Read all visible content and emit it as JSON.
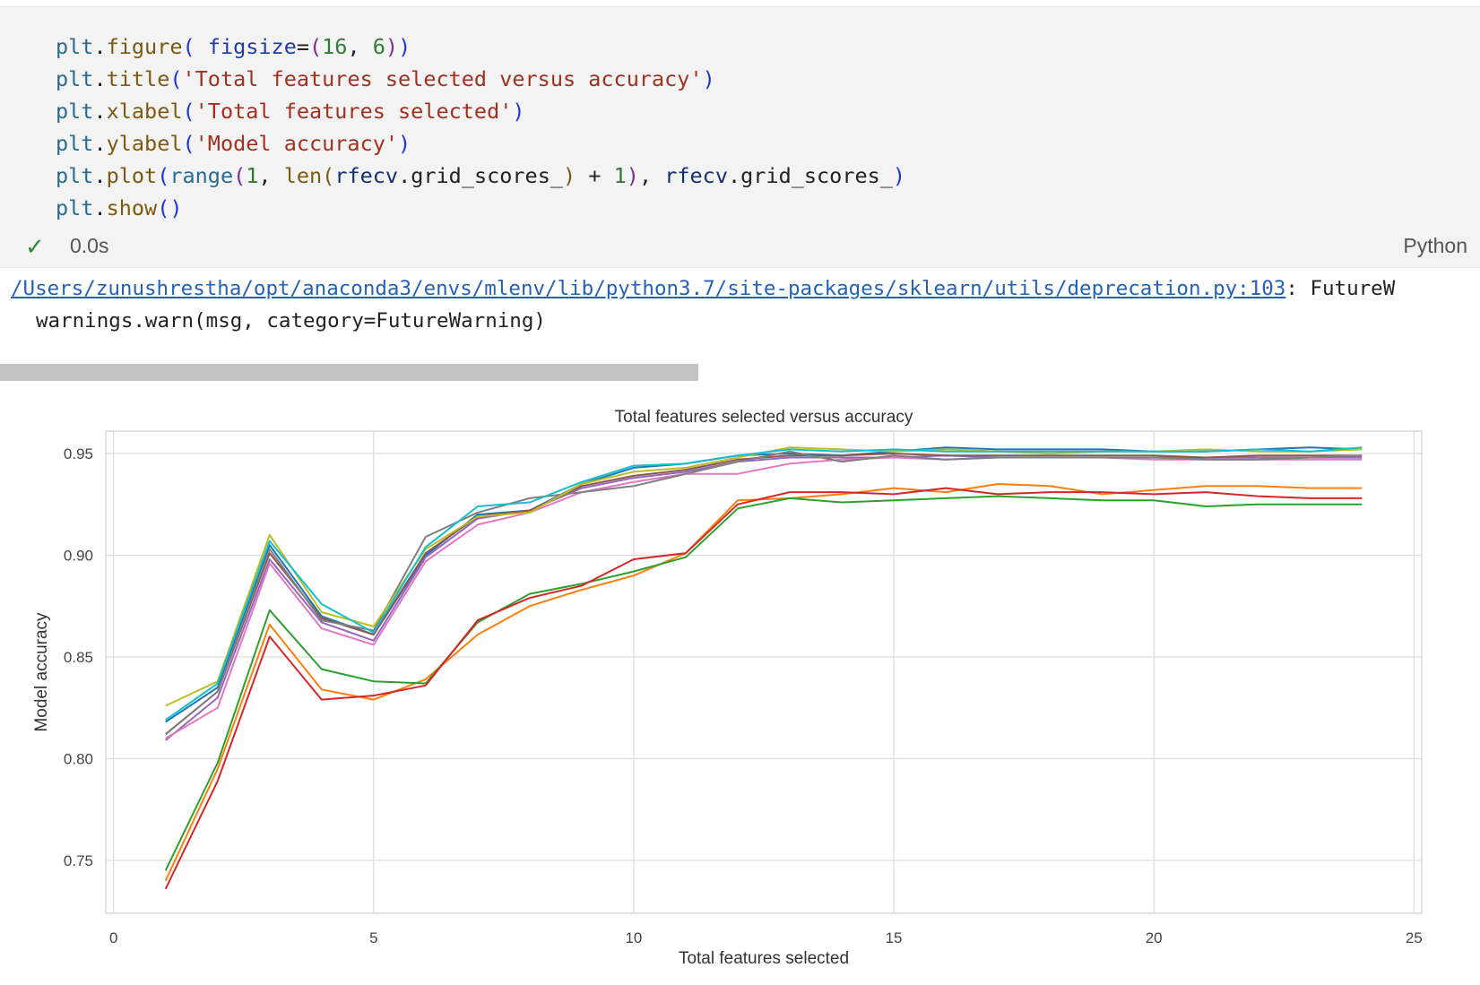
{
  "code_cell": {
    "lines": [
      [
        {
          "t": "plt",
          "c": "v"
        },
        {
          "t": ".",
          "c": "o"
        },
        {
          "t": "figure",
          "c": "f"
        },
        {
          "t": "(",
          "c": "p1"
        },
        {
          "t": " figsize",
          "c": "a"
        },
        {
          "t": "=",
          "c": "o"
        },
        {
          "t": "(",
          "c": "p2"
        },
        {
          "t": "16",
          "c": "n"
        },
        {
          "t": ", ",
          "c": "o"
        },
        {
          "t": "6",
          "c": "n"
        },
        {
          "t": ")",
          "c": "p2"
        },
        {
          "t": ")",
          "c": "p1"
        }
      ],
      [
        {
          "t": "plt",
          "c": "v"
        },
        {
          "t": ".",
          "c": "o"
        },
        {
          "t": "title",
          "c": "f"
        },
        {
          "t": "(",
          "c": "p1"
        },
        {
          "t": "'Total features selected versus accuracy'",
          "c": "s"
        },
        {
          "t": ")",
          "c": "p1"
        }
      ],
      [
        {
          "t": "plt",
          "c": "v"
        },
        {
          "t": ".",
          "c": "o"
        },
        {
          "t": "xlabel",
          "c": "f"
        },
        {
          "t": "(",
          "c": "p1"
        },
        {
          "t": "'Total features selected'",
          "c": "s"
        },
        {
          "t": ")",
          "c": "p1"
        }
      ],
      [
        {
          "t": "plt",
          "c": "v"
        },
        {
          "t": ".",
          "c": "o"
        },
        {
          "t": "ylabel",
          "c": "f"
        },
        {
          "t": "(",
          "c": "p1"
        },
        {
          "t": "'Model accuracy'",
          "c": "s"
        },
        {
          "t": ")",
          "c": "p1"
        }
      ],
      [
        {
          "t": "plt",
          "c": "v"
        },
        {
          "t": ".",
          "c": "o"
        },
        {
          "t": "plot",
          "c": "f"
        },
        {
          "t": "(",
          "c": "p1"
        },
        {
          "t": "range",
          "c": "v"
        },
        {
          "t": "(",
          "c": "p2"
        },
        {
          "t": "1",
          "c": "n"
        },
        {
          "t": ", ",
          "c": "o"
        },
        {
          "t": "len",
          "c": "f"
        },
        {
          "t": "(",
          "c": "f"
        },
        {
          "t": "rfecv",
          "c": "id"
        },
        {
          "t": ".grid_scores_",
          "c": "o"
        },
        {
          "t": ")",
          "c": "f"
        },
        {
          "t": " + ",
          "c": "o"
        },
        {
          "t": "1",
          "c": "n"
        },
        {
          "t": ")",
          "c": "p2"
        },
        {
          "t": ", ",
          "c": "o"
        },
        {
          "t": "rfecv",
          "c": "id"
        },
        {
          "t": ".grid_scores_",
          "c": "o"
        },
        {
          "t": ")",
          "c": "p1"
        }
      ],
      [
        {
          "t": "plt",
          "c": "v"
        },
        {
          "t": ".",
          "c": "o"
        },
        {
          "t": "show",
          "c": "f"
        },
        {
          "t": "()",
          "c": "p1"
        }
      ]
    ],
    "status": {
      "check_icon": "check-icon",
      "time": "0.0s",
      "language": "Python"
    }
  },
  "output": {
    "warning_path": "/Users/zunushrestha/opt/anaconda3/envs/mlenv/lib/python3.7/site-packages/sklearn/utils/deprecation.py:103",
    "warning_rest": ": FutureW",
    "warning_line2": "warnings.warn(msg, category=FutureWarning)"
  },
  "chart_data": {
    "type": "line",
    "title": "Total features selected versus accuracy",
    "xlabel": "Total features selected",
    "ylabel": "Model accuracy",
    "xlim": [
      -0.15,
      25.15
    ],
    "ylim": [
      0.724,
      0.961
    ],
    "xticks": [
      0,
      5,
      10,
      15,
      20,
      25
    ],
    "yticks": [
      0.75,
      0.8,
      0.85,
      0.9,
      0.95
    ],
    "grid": true,
    "legend": false,
    "x": [
      1,
      2,
      3,
      4,
      5,
      6,
      7,
      8,
      9,
      10,
      11,
      12,
      13,
      14,
      15,
      16,
      17,
      18,
      19,
      20,
      21,
      22,
      23,
      24
    ],
    "series": [
      {
        "color": "#1f77b4",
        "values": [
          0.818,
          0.835,
          0.905,
          0.87,
          0.861,
          0.9,
          0.92,
          0.922,
          0.935,
          0.943,
          0.945,
          0.949,
          0.95,
          0.949,
          0.951,
          0.953,
          0.952,
          0.952,
          0.952,
          0.951,
          0.951,
          0.952,
          0.953,
          0.952
        ]
      },
      {
        "color": "#ff7f0e",
        "values": [
          0.74,
          0.795,
          0.866,
          0.834,
          0.829,
          0.839,
          0.861,
          0.875,
          0.883,
          0.89,
          0.901,
          0.927,
          0.928,
          0.93,
          0.933,
          0.931,
          0.935,
          0.934,
          0.93,
          0.932,
          0.934,
          0.934,
          0.933,
          0.933
        ]
      },
      {
        "color": "#2ca02c",
        "values": [
          0.745,
          0.798,
          0.873,
          0.844,
          0.838,
          0.837,
          0.867,
          0.881,
          0.886,
          0.892,
          0.899,
          0.923,
          0.928,
          0.926,
          0.927,
          0.928,
          0.929,
          0.928,
          0.927,
          0.927,
          0.924,
          0.925,
          0.925,
          0.925
        ]
      },
      {
        "color": "#d62728",
        "values": [
          0.736,
          0.789,
          0.86,
          0.829,
          0.831,
          0.836,
          0.868,
          0.879,
          0.885,
          0.898,
          0.901,
          0.925,
          0.931,
          0.931,
          0.93,
          0.933,
          0.93,
          0.931,
          0.931,
          0.93,
          0.931,
          0.929,
          0.928,
          0.928
        ]
      },
      {
        "color": "#9467bd",
        "values": [
          0.809,
          0.83,
          0.898,
          0.867,
          0.858,
          0.899,
          0.918,
          0.922,
          0.933,
          0.938,
          0.941,
          0.946,
          0.948,
          0.948,
          0.948,
          0.949,
          0.948,
          0.948,
          0.948,
          0.948,
          0.948,
          0.948,
          0.948,
          0.948
        ]
      },
      {
        "color": "#8c564b",
        "values": [
          0.812,
          0.833,
          0.901,
          0.869,
          0.861,
          0.901,
          0.919,
          0.922,
          0.934,
          0.939,
          0.942,
          0.947,
          0.949,
          0.949,
          0.95,
          0.949,
          0.949,
          0.949,
          0.949,
          0.949,
          0.948,
          0.949,
          0.949,
          0.949
        ]
      },
      {
        "color": "#e377c2",
        "values": [
          0.81,
          0.825,
          0.896,
          0.864,
          0.856,
          0.897,
          0.915,
          0.921,
          0.931,
          0.936,
          0.94,
          0.94,
          0.945,
          0.947,
          0.948,
          0.947,
          0.948,
          0.948,
          0.948,
          0.947,
          0.947,
          0.947,
          0.947,
          0.947
        ]
      },
      {
        "color": "#7f7f7f",
        "values": [
          0.812,
          0.833,
          0.903,
          0.868,
          0.863,
          0.909,
          0.921,
          0.928,
          0.931,
          0.934,
          0.94,
          0.946,
          0.951,
          0.946,
          0.949,
          0.947,
          0.948,
          0.948,
          0.948,
          0.948,
          0.947,
          0.947,
          0.948,
          0.949
        ]
      },
      {
        "color": "#bcbd22",
        "values": [
          0.826,
          0.838,
          0.91,
          0.872,
          0.865,
          0.903,
          0.919,
          0.921,
          0.935,
          0.941,
          0.943,
          0.948,
          0.953,
          0.952,
          0.951,
          0.952,
          0.951,
          0.95,
          0.951,
          0.951,
          0.952,
          0.951,
          0.951,
          0.952
        ]
      },
      {
        "color": "#17becf",
        "values": [
          0.819,
          0.837,
          0.907,
          0.876,
          0.862,
          0.904,
          0.924,
          0.926,
          0.936,
          0.944,
          0.945,
          0.949,
          0.952,
          0.951,
          0.952,
          0.951,
          0.951,
          0.951,
          0.951,
          0.951,
          0.951,
          0.952,
          0.951,
          0.953
        ]
      }
    ]
  }
}
